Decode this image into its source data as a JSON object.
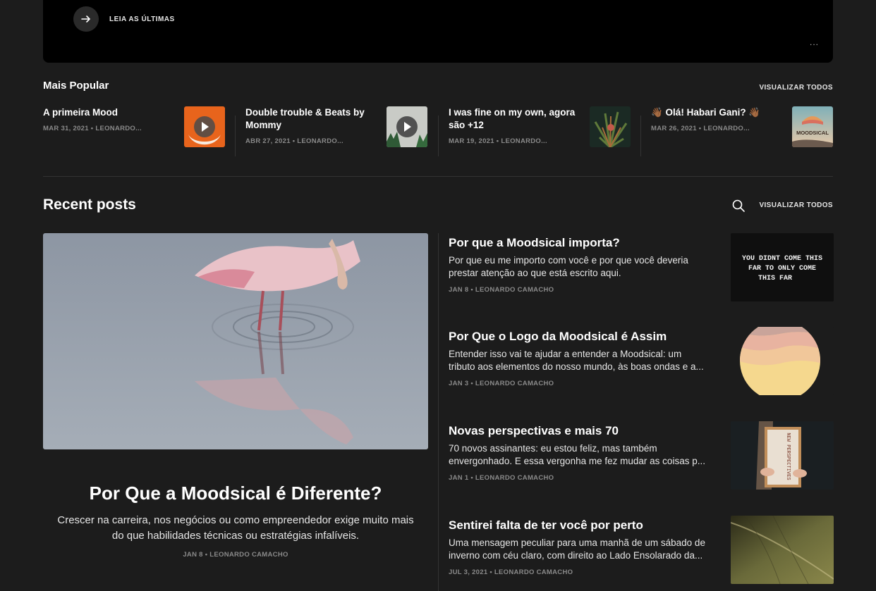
{
  "hero": {
    "read_latest_label": "LEIA AS ÚLTIMAS",
    "more_label": "..."
  },
  "popular": {
    "title": "Mais Popular",
    "view_all": "VISUALIZAR TODOS",
    "items": [
      {
        "title": "A primeira Mood",
        "meta": "MAR 31, 2021 • LEONARDO...",
        "thumb": "orange-play-thumbnail"
      },
      {
        "title": "Double trouble & Beats by Mommy",
        "meta": "ABR 27, 2021 • LEONARDO...",
        "thumb": "gray-play-thumbnail"
      },
      {
        "title": "I was fine on my own, agora são +12",
        "meta": "MAR 19, 2021 • LEONARDO...",
        "thumb": "plant-thumbnail"
      },
      {
        "title": "👋🏾 Olá! Habari Gani? 👋🏾",
        "meta": "MAR 26, 2021 • LEONARDO...",
        "thumb": "moodsical-logo-thumbnail",
        "thumb_text": "MOODSICAL"
      }
    ]
  },
  "recent": {
    "title": "Recent posts",
    "view_all": "VISUALIZAR TODOS",
    "featured": {
      "title": "Por Que a Moodsical é Diferente?",
      "excerpt": "Crescer na carreira, nos negócios ou como empreendedor exige muito mais do que habilidades técnicas ou estratégias infalíveis.",
      "meta": "JAN 8 • LEONARDO CAMACHO"
    },
    "posts": [
      {
        "title": "Por que a Moodsical importa?",
        "excerpt_lines": [
          "Por que eu me importo com você e por que você deveria",
          "prestar atenção ao que está escrito aqui."
        ],
        "meta": "JAN 8 • LEONARDO CAMACHO",
        "thumb_lines": [
          "YOU DIDNT COME THIS",
          "FAR TO ONLY COME",
          "THIS FAR"
        ]
      },
      {
        "title": "Por Que o Logo da Moodsical é Assim",
        "excerpt_lines": [
          "Entender isso vai te ajudar a entender a Moodsical: um",
          "tributo aos elementos do nosso mundo, às boas ondas e a..."
        ],
        "meta": "JAN 3 • LEONARDO CAMACHO"
      },
      {
        "title": "Novas perspectivas e mais 70",
        "excerpt_lines": [
          "70 novos assinantes: eu estou feliz, mas também",
          "envergonhado. E essa vergonha me fez mudar as coisas p..."
        ],
        "meta": "JAN 1 • LEONARDO CAMACHO",
        "thumb_text": "NEW PERSPECTIVES"
      },
      {
        "title": "Sentirei falta de ter você por perto",
        "excerpt_lines": [
          "Uma mensagem peculiar para uma manhã de um sábado de",
          "inverno com céu claro, com direito ao Lado Ensolarado da..."
        ],
        "meta": "JUL 3, 2021 • LEONARDO CAMACHO"
      }
    ]
  }
}
